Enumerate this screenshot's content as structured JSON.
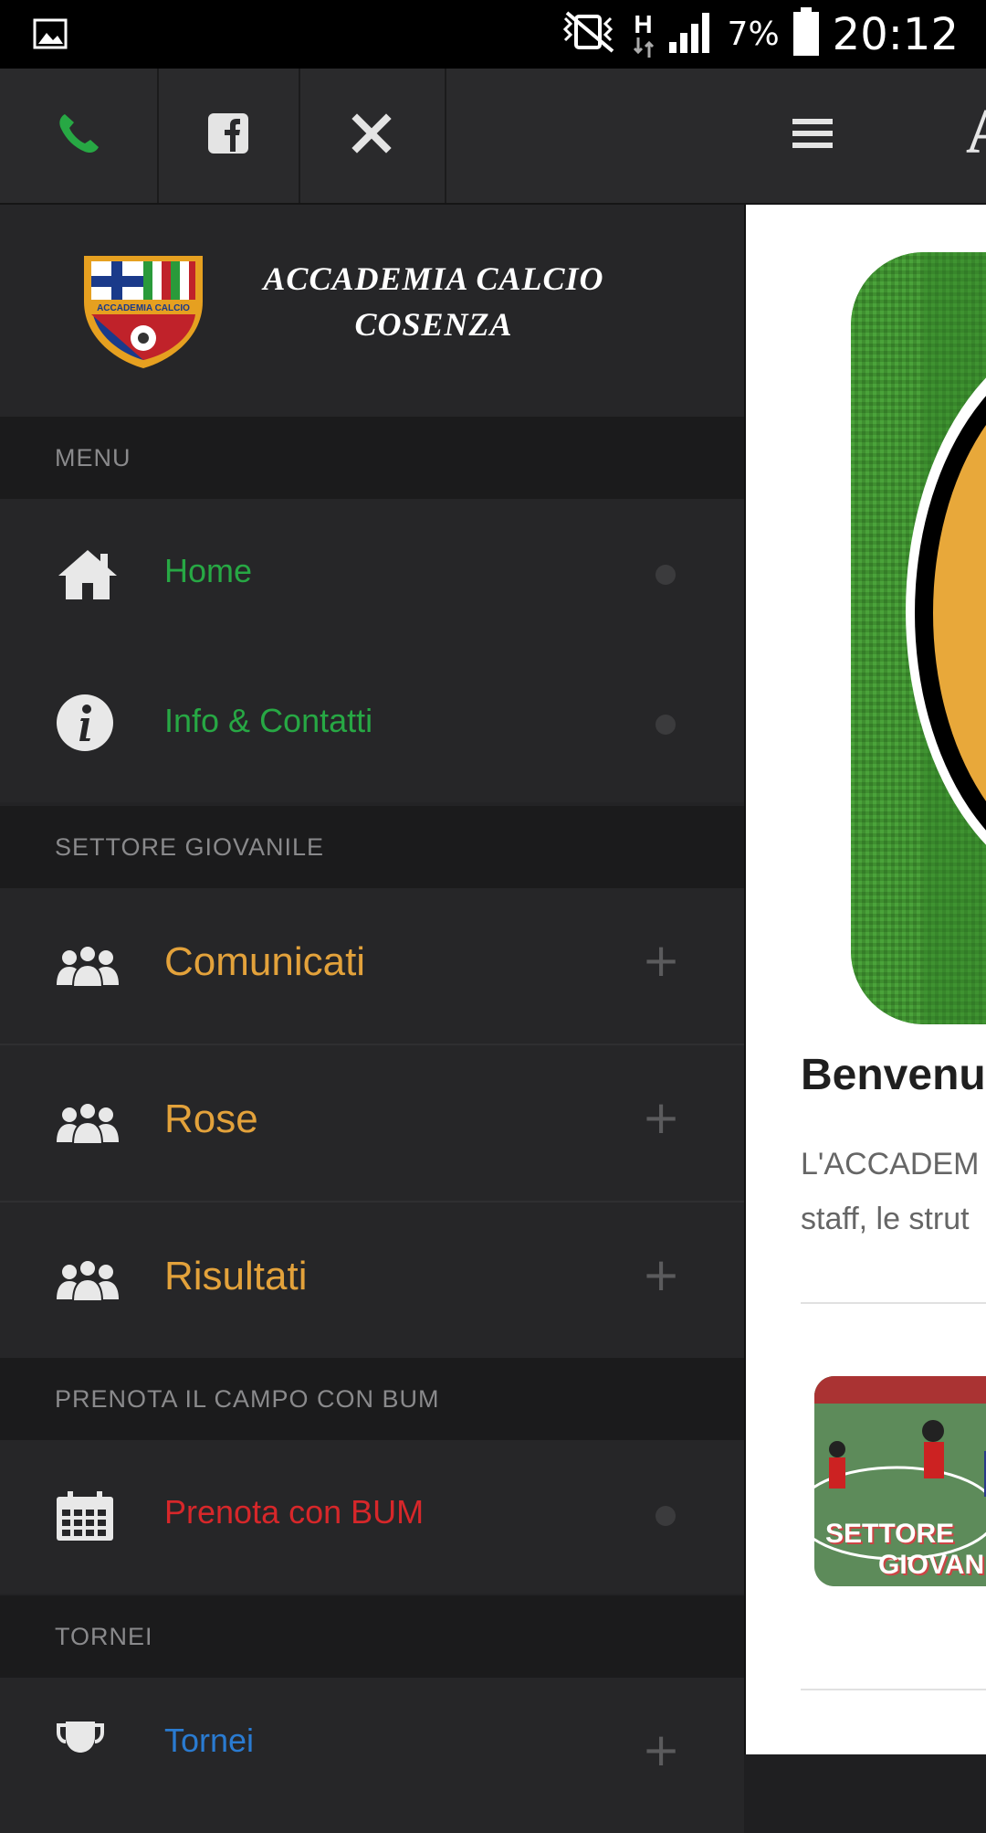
{
  "status": {
    "battery": "7%",
    "time": "20:12",
    "network": "H"
  },
  "topbar": {
    "title_partial": "A"
  },
  "brand": {
    "line1": "ACCADEMIA CALCIO",
    "line2": "COSENZA",
    "logo_text": "ACCADEMIA CALCIO"
  },
  "sections": {
    "menu": "MENU",
    "settore": "SETTORE GIOVANILE",
    "prenota": "PRENOTA IL CAMPO CON BUM",
    "tornei": "TORNEI"
  },
  "menu_items": {
    "home": "Home",
    "info": "Info & Contatti",
    "comunicati": "Comunicati",
    "rose": "Rose",
    "risultati": "Risultati",
    "prenota": "Prenota con BUM",
    "tornei": "Tornei"
  },
  "plus_glyph": "+",
  "content": {
    "welcome_title": "Benvenut",
    "welcome_line1": "L'ACCADEM",
    "welcome_line2": "staff, le strut",
    "thumb_line1": "SETTORE",
    "thumb_line2": "GIOVANI"
  },
  "colors": {
    "green": "#27a844",
    "orange": "#e3a23b",
    "red": "#d7272a",
    "blue": "#2a7bd1"
  }
}
